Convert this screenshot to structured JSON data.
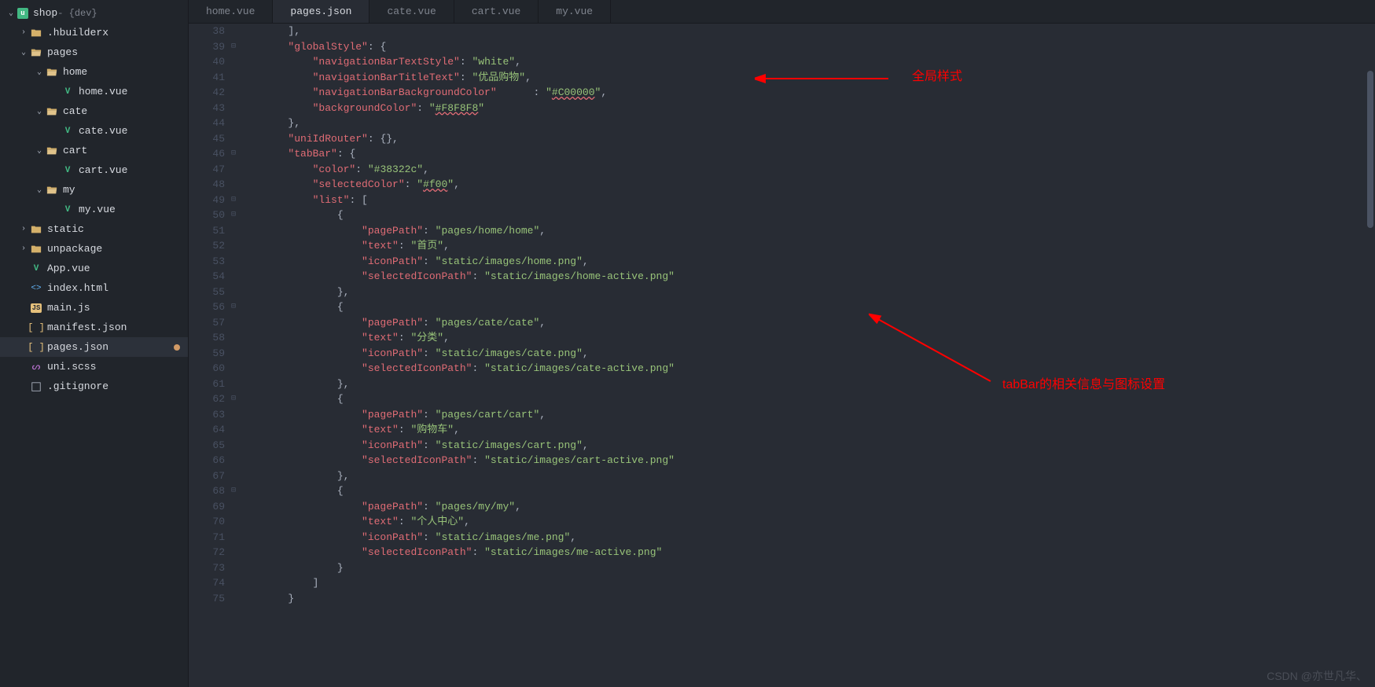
{
  "project": {
    "name": "shop",
    "suffix": " - {dev}"
  },
  "tree": [
    {
      "label": ".hbuilderx",
      "type": "folder",
      "indent": 1,
      "chev": "›"
    },
    {
      "label": "pages",
      "type": "folder-open",
      "indent": 1,
      "chev": "⌄"
    },
    {
      "label": "home",
      "type": "folder-open",
      "indent": 2,
      "chev": "⌄"
    },
    {
      "label": "home.vue",
      "type": "vue",
      "indent": 3
    },
    {
      "label": "cate",
      "type": "folder-open",
      "indent": 2,
      "chev": "⌄"
    },
    {
      "label": "cate.vue",
      "type": "vue",
      "indent": 3
    },
    {
      "label": "cart",
      "type": "folder-open",
      "indent": 2,
      "chev": "⌄"
    },
    {
      "label": "cart.vue",
      "type": "vue",
      "indent": 3
    },
    {
      "label": "my",
      "type": "folder-open",
      "indent": 2,
      "chev": "⌄"
    },
    {
      "label": "my.vue",
      "type": "vue",
      "indent": 3
    },
    {
      "label": "static",
      "type": "folder",
      "indent": 1,
      "chev": "›"
    },
    {
      "label": "unpackage",
      "type": "folder",
      "indent": 1,
      "chev": "›"
    },
    {
      "label": "App.vue",
      "type": "vue",
      "indent": 1
    },
    {
      "label": "index.html",
      "type": "html",
      "indent": 1
    },
    {
      "label": "main.js",
      "type": "js",
      "indent": 1
    },
    {
      "label": "manifest.json",
      "type": "json",
      "indent": 1
    },
    {
      "label": "pages.json",
      "type": "json",
      "indent": 1,
      "active": true,
      "modified": true
    },
    {
      "label": "uni.scss",
      "type": "scss",
      "indent": 1
    },
    {
      "label": ".gitignore",
      "type": "git",
      "indent": 1
    }
  ],
  "tabs": [
    {
      "label": "home.vue"
    },
    {
      "label": "pages.json",
      "active": true
    },
    {
      "label": "cate.vue"
    },
    {
      "label": "cart.vue"
    },
    {
      "label": "my.vue"
    }
  ],
  "lineStart": 38,
  "code": [
    {
      "t": [
        {
          "c": "        "
        },
        {
          "c": "],",
          "k": "punct"
        }
      ]
    },
    {
      "f": "⊟",
      "t": [
        {
          "c": "        "
        },
        {
          "c": "\"globalStyle\"",
          "k": "key"
        },
        {
          "c": ": {",
          "k": "punct"
        }
      ]
    },
    {
      "t": [
        {
          "c": "            "
        },
        {
          "c": "\"navigationBarTextStyle\"",
          "k": "key"
        },
        {
          "c": ": ",
          "k": "punct"
        },
        {
          "c": "\"white\"",
          "k": "string"
        },
        {
          "c": ",",
          "k": "punct"
        }
      ]
    },
    {
      "t": [
        {
          "c": "            "
        },
        {
          "c": "\"navigationBarTitleText\"",
          "k": "key"
        },
        {
          "c": ": ",
          "k": "punct"
        },
        {
          "c": "\"优品购物\"",
          "k": "string"
        },
        {
          "c": ",",
          "k": "punct"
        }
      ]
    },
    {
      "t": [
        {
          "c": "            "
        },
        {
          "c": "\"navigationBarBackgroundColor\"",
          "k": "key"
        },
        {
          "c": "      : ",
          "k": "punct"
        },
        {
          "c": "\"",
          "k": "string"
        },
        {
          "c": "#C00000",
          "k": "err"
        },
        {
          "c": "\"",
          "k": "string"
        },
        {
          "c": ",",
          "k": "punct"
        }
      ]
    },
    {
      "t": [
        {
          "c": "            "
        },
        {
          "c": "\"backgroundColor\"",
          "k": "key"
        },
        {
          "c": ": ",
          "k": "punct"
        },
        {
          "c": "\"",
          "k": "string"
        },
        {
          "c": "#F8F8F8",
          "k": "err"
        },
        {
          "c": "\"",
          "k": "string"
        }
      ]
    },
    {
      "t": [
        {
          "c": "        "
        },
        {
          "c": "},",
          "k": "punct"
        }
      ]
    },
    {
      "t": [
        {
          "c": "        "
        },
        {
          "c": "\"uniIdRouter\"",
          "k": "key"
        },
        {
          "c": ": {},",
          "k": "punct"
        }
      ]
    },
    {
      "f": "⊟",
      "t": [
        {
          "c": "        "
        },
        {
          "c": "\"tabBar\"",
          "k": "key"
        },
        {
          "c": ": {",
          "k": "punct"
        }
      ]
    },
    {
      "t": [
        {
          "c": "            "
        },
        {
          "c": "\"color\"",
          "k": "key"
        },
        {
          "c": ": ",
          "k": "punct"
        },
        {
          "c": "\"#38322c\"",
          "k": "string"
        },
        {
          "c": ",",
          "k": "punct"
        }
      ]
    },
    {
      "t": [
        {
          "c": "            "
        },
        {
          "c": "\"selectedColor\"",
          "k": "key"
        },
        {
          "c": ": ",
          "k": "punct"
        },
        {
          "c": "\"",
          "k": "string"
        },
        {
          "c": "#f00",
          "k": "err"
        },
        {
          "c": "\"",
          "k": "string"
        },
        {
          "c": ",",
          "k": "punct"
        }
      ]
    },
    {
      "f": "⊟",
      "t": [
        {
          "c": "            "
        },
        {
          "c": "\"list\"",
          "k": "key"
        },
        {
          "c": ": [",
          "k": "punct"
        }
      ]
    },
    {
      "f": "⊟",
      "t": [
        {
          "c": "                {",
          "k": "punct"
        }
      ]
    },
    {
      "t": [
        {
          "c": "                    "
        },
        {
          "c": "\"pagePath\"",
          "k": "key"
        },
        {
          "c": ": ",
          "k": "punct"
        },
        {
          "c": "\"pages/home/home\"",
          "k": "string"
        },
        {
          "c": ",",
          "k": "punct"
        }
      ]
    },
    {
      "t": [
        {
          "c": "                    "
        },
        {
          "c": "\"text\"",
          "k": "key"
        },
        {
          "c": ": ",
          "k": "punct"
        },
        {
          "c": "\"首页\"",
          "k": "string"
        },
        {
          "c": ",",
          "k": "punct"
        }
      ]
    },
    {
      "t": [
        {
          "c": "                    "
        },
        {
          "c": "\"iconPath\"",
          "k": "key"
        },
        {
          "c": ": ",
          "k": "punct"
        },
        {
          "c": "\"static/images/home.png\"",
          "k": "string"
        },
        {
          "c": ",",
          "k": "punct"
        }
      ]
    },
    {
      "t": [
        {
          "c": "                    "
        },
        {
          "c": "\"selectedIconPath\"",
          "k": "key"
        },
        {
          "c": ": ",
          "k": "punct"
        },
        {
          "c": "\"static/images/home-active.png\"",
          "k": "string"
        }
      ]
    },
    {
      "t": [
        {
          "c": "                "
        },
        {
          "c": "},",
          "k": "punct"
        }
      ]
    },
    {
      "f": "⊟",
      "t": [
        {
          "c": "                {",
          "k": "punct"
        }
      ]
    },
    {
      "t": [
        {
          "c": "                    "
        },
        {
          "c": "\"pagePath\"",
          "k": "key"
        },
        {
          "c": ": ",
          "k": "punct"
        },
        {
          "c": "\"pages/cate/cate\"",
          "k": "string"
        },
        {
          "c": ",",
          "k": "punct"
        }
      ]
    },
    {
      "t": [
        {
          "c": "                    "
        },
        {
          "c": "\"text\"",
          "k": "key"
        },
        {
          "c": ": ",
          "k": "punct"
        },
        {
          "c": "\"分类\"",
          "k": "string"
        },
        {
          "c": ",",
          "k": "punct"
        }
      ]
    },
    {
      "t": [
        {
          "c": "                    "
        },
        {
          "c": "\"iconPath\"",
          "k": "key"
        },
        {
          "c": ": ",
          "k": "punct"
        },
        {
          "c": "\"static/images/cate.png\"",
          "k": "string"
        },
        {
          "c": ",",
          "k": "punct"
        }
      ]
    },
    {
      "t": [
        {
          "c": "                    "
        },
        {
          "c": "\"selectedIconPath\"",
          "k": "key"
        },
        {
          "c": ": ",
          "k": "punct"
        },
        {
          "c": "\"static/images/cate-active.png\"",
          "k": "string"
        }
      ]
    },
    {
      "t": [
        {
          "c": "                "
        },
        {
          "c": "},",
          "k": "punct"
        }
      ]
    },
    {
      "f": "⊟",
      "t": [
        {
          "c": "                {",
          "k": "punct"
        }
      ]
    },
    {
      "t": [
        {
          "c": "                    "
        },
        {
          "c": "\"pagePath\"",
          "k": "key"
        },
        {
          "c": ": ",
          "k": "punct"
        },
        {
          "c": "\"pages/cart/cart\"",
          "k": "string"
        },
        {
          "c": ",",
          "k": "punct"
        }
      ]
    },
    {
      "t": [
        {
          "c": "                    "
        },
        {
          "c": "\"text\"",
          "k": "key"
        },
        {
          "c": ": ",
          "k": "punct"
        },
        {
          "c": "\"购物车\"",
          "k": "string"
        },
        {
          "c": ",",
          "k": "punct"
        }
      ]
    },
    {
      "t": [
        {
          "c": "                    "
        },
        {
          "c": "\"iconPath\"",
          "k": "key"
        },
        {
          "c": ": ",
          "k": "punct"
        },
        {
          "c": "\"static/images/cart.png\"",
          "k": "string"
        },
        {
          "c": ",",
          "k": "punct"
        }
      ]
    },
    {
      "t": [
        {
          "c": "                    "
        },
        {
          "c": "\"selectedIconPath\"",
          "k": "key"
        },
        {
          "c": ": ",
          "k": "punct"
        },
        {
          "c": "\"static/images/cart-active.png\"",
          "k": "string"
        }
      ]
    },
    {
      "t": [
        {
          "c": "                "
        },
        {
          "c": "},",
          "k": "punct"
        }
      ]
    },
    {
      "f": "⊟",
      "t": [
        {
          "c": "                {",
          "k": "punct"
        }
      ]
    },
    {
      "t": [
        {
          "c": "                    "
        },
        {
          "c": "\"pagePath\"",
          "k": "key"
        },
        {
          "c": ": ",
          "k": "punct"
        },
        {
          "c": "\"pages/my/my\"",
          "k": "string"
        },
        {
          "c": ",",
          "k": "punct"
        }
      ]
    },
    {
      "t": [
        {
          "c": "                    "
        },
        {
          "c": "\"text\"",
          "k": "key"
        },
        {
          "c": ": ",
          "k": "punct"
        },
        {
          "c": "\"个人中心\"",
          "k": "string"
        },
        {
          "c": ",",
          "k": "punct"
        }
      ]
    },
    {
      "t": [
        {
          "c": "                    "
        },
        {
          "c": "\"iconPath\"",
          "k": "key"
        },
        {
          "c": ": ",
          "k": "punct"
        },
        {
          "c": "\"static/images/me.png\"",
          "k": "string"
        },
        {
          "c": ",",
          "k": "punct"
        }
      ]
    },
    {
      "t": [
        {
          "c": "                    "
        },
        {
          "c": "\"selectedIconPath\"",
          "k": "key"
        },
        {
          "c": ": ",
          "k": "punct"
        },
        {
          "c": "\"static/images/me-active.png\"",
          "k": "string"
        }
      ]
    },
    {
      "t": [
        {
          "c": "                "
        },
        {
          "c": "}",
          "k": "punct"
        }
      ]
    },
    {
      "t": [
        {
          "c": "            "
        },
        {
          "c": "]",
          "k": "punct"
        }
      ]
    },
    {
      "t": [
        {
          "c": "        "
        },
        {
          "c": "}",
          "k": "punct"
        }
      ]
    }
  ],
  "annotations": {
    "globalStyle": "全局样式",
    "tabBar": "tabBar的相关信息与图标设置"
  },
  "watermark": "CSDN @亦世凡华、"
}
